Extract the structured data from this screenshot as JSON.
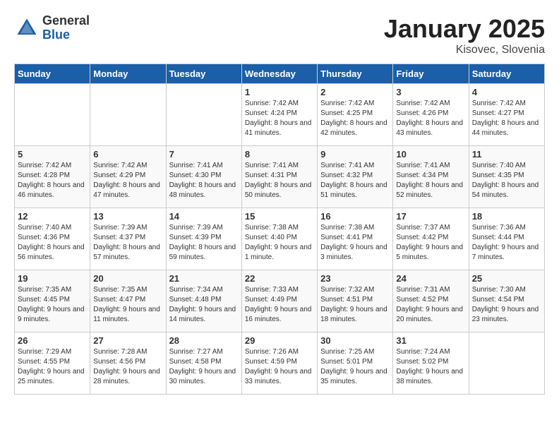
{
  "logo": {
    "general": "General",
    "blue": "Blue"
  },
  "header": {
    "month_title": "January 2025",
    "subtitle": "Kisovec, Slovenia"
  },
  "days_of_week": [
    "Sunday",
    "Monday",
    "Tuesday",
    "Wednesday",
    "Thursday",
    "Friday",
    "Saturday"
  ],
  "weeks": [
    [
      {
        "day": "",
        "info": ""
      },
      {
        "day": "",
        "info": ""
      },
      {
        "day": "",
        "info": ""
      },
      {
        "day": "1",
        "info": "Sunrise: 7:42 AM\nSunset: 4:24 PM\nDaylight: 8 hours and 41 minutes."
      },
      {
        "day": "2",
        "info": "Sunrise: 7:42 AM\nSunset: 4:25 PM\nDaylight: 8 hours and 42 minutes."
      },
      {
        "day": "3",
        "info": "Sunrise: 7:42 AM\nSunset: 4:26 PM\nDaylight: 8 hours and 43 minutes."
      },
      {
        "day": "4",
        "info": "Sunrise: 7:42 AM\nSunset: 4:27 PM\nDaylight: 8 hours and 44 minutes."
      }
    ],
    [
      {
        "day": "5",
        "info": "Sunrise: 7:42 AM\nSunset: 4:28 PM\nDaylight: 8 hours and 46 minutes."
      },
      {
        "day": "6",
        "info": "Sunrise: 7:42 AM\nSunset: 4:29 PM\nDaylight: 8 hours and 47 minutes."
      },
      {
        "day": "7",
        "info": "Sunrise: 7:41 AM\nSunset: 4:30 PM\nDaylight: 8 hours and 48 minutes."
      },
      {
        "day": "8",
        "info": "Sunrise: 7:41 AM\nSunset: 4:31 PM\nDaylight: 8 hours and 50 minutes."
      },
      {
        "day": "9",
        "info": "Sunrise: 7:41 AM\nSunset: 4:32 PM\nDaylight: 8 hours and 51 minutes."
      },
      {
        "day": "10",
        "info": "Sunrise: 7:41 AM\nSunset: 4:34 PM\nDaylight: 8 hours and 52 minutes."
      },
      {
        "day": "11",
        "info": "Sunrise: 7:40 AM\nSunset: 4:35 PM\nDaylight: 8 hours and 54 minutes."
      }
    ],
    [
      {
        "day": "12",
        "info": "Sunrise: 7:40 AM\nSunset: 4:36 PM\nDaylight: 8 hours and 56 minutes."
      },
      {
        "day": "13",
        "info": "Sunrise: 7:39 AM\nSunset: 4:37 PM\nDaylight: 8 hours and 57 minutes."
      },
      {
        "day": "14",
        "info": "Sunrise: 7:39 AM\nSunset: 4:39 PM\nDaylight: 8 hours and 59 minutes."
      },
      {
        "day": "15",
        "info": "Sunrise: 7:38 AM\nSunset: 4:40 PM\nDaylight: 9 hours and 1 minute."
      },
      {
        "day": "16",
        "info": "Sunrise: 7:38 AM\nSunset: 4:41 PM\nDaylight: 9 hours and 3 minutes."
      },
      {
        "day": "17",
        "info": "Sunrise: 7:37 AM\nSunset: 4:42 PM\nDaylight: 9 hours and 5 minutes."
      },
      {
        "day": "18",
        "info": "Sunrise: 7:36 AM\nSunset: 4:44 PM\nDaylight: 9 hours and 7 minutes."
      }
    ],
    [
      {
        "day": "19",
        "info": "Sunrise: 7:35 AM\nSunset: 4:45 PM\nDaylight: 9 hours and 9 minutes."
      },
      {
        "day": "20",
        "info": "Sunrise: 7:35 AM\nSunset: 4:47 PM\nDaylight: 9 hours and 11 minutes."
      },
      {
        "day": "21",
        "info": "Sunrise: 7:34 AM\nSunset: 4:48 PM\nDaylight: 9 hours and 14 minutes."
      },
      {
        "day": "22",
        "info": "Sunrise: 7:33 AM\nSunset: 4:49 PM\nDaylight: 9 hours and 16 minutes."
      },
      {
        "day": "23",
        "info": "Sunrise: 7:32 AM\nSunset: 4:51 PM\nDaylight: 9 hours and 18 minutes."
      },
      {
        "day": "24",
        "info": "Sunrise: 7:31 AM\nSunset: 4:52 PM\nDaylight: 9 hours and 20 minutes."
      },
      {
        "day": "25",
        "info": "Sunrise: 7:30 AM\nSunset: 4:54 PM\nDaylight: 9 hours and 23 minutes."
      }
    ],
    [
      {
        "day": "26",
        "info": "Sunrise: 7:29 AM\nSunset: 4:55 PM\nDaylight: 9 hours and 25 minutes."
      },
      {
        "day": "27",
        "info": "Sunrise: 7:28 AM\nSunset: 4:56 PM\nDaylight: 9 hours and 28 minutes."
      },
      {
        "day": "28",
        "info": "Sunrise: 7:27 AM\nSunset: 4:58 PM\nDaylight: 9 hours and 30 minutes."
      },
      {
        "day": "29",
        "info": "Sunrise: 7:26 AM\nSunset: 4:59 PM\nDaylight: 9 hours and 33 minutes."
      },
      {
        "day": "30",
        "info": "Sunrise: 7:25 AM\nSunset: 5:01 PM\nDaylight: 9 hours and 35 minutes."
      },
      {
        "day": "31",
        "info": "Sunrise: 7:24 AM\nSunset: 5:02 PM\nDaylight: 9 hours and 38 minutes."
      },
      {
        "day": "",
        "info": ""
      }
    ]
  ]
}
